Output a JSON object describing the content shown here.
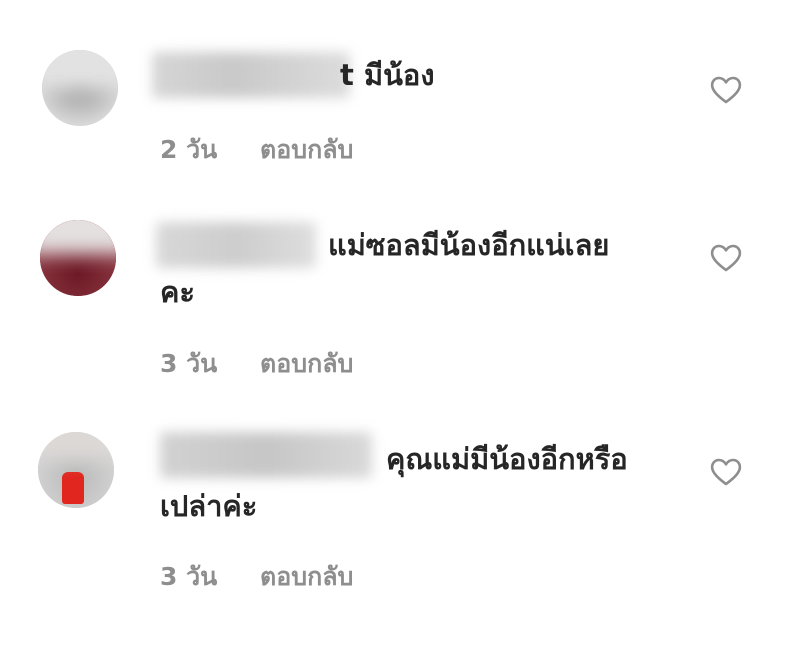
{
  "comments": [
    {
      "visible_username_fragment": "t",
      "text": "มีน้อง",
      "time": "2 วัน",
      "reply_label": "ตอบกลับ"
    },
    {
      "text_line1": "แม่ซอลมีน้องอีกแน่เลย",
      "text_line2": "คะ",
      "time": "3 วัน",
      "reply_label": "ตอบกลับ"
    },
    {
      "text_line1": "คุณแม่มีน้องอีกหรือ",
      "text_line2": "เปล่าค่ะ",
      "time": "3 วัน",
      "reply_label": "ตอบกลับ"
    }
  ],
  "icons": {
    "like": "heart-outline-icon"
  },
  "colors": {
    "text": "#262626",
    "meta": "#8e8e8e",
    "icon": "#8e8e8e"
  }
}
